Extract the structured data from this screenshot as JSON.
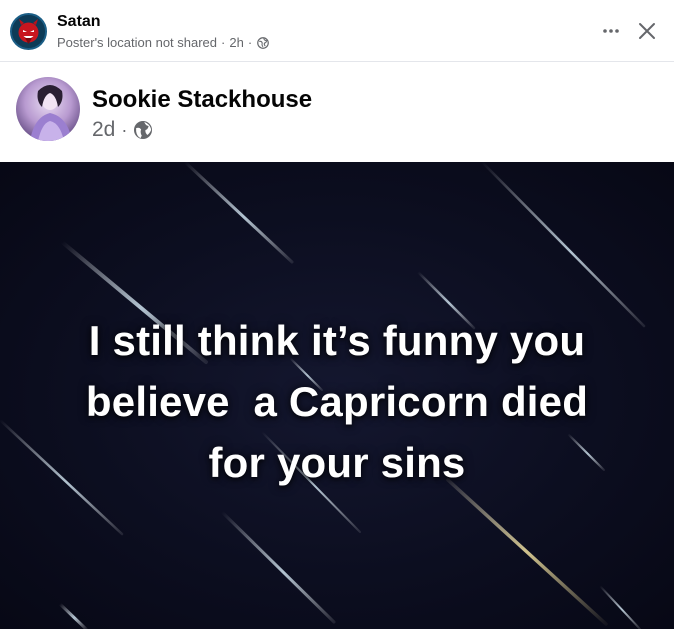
{
  "sharer": {
    "name": "Satan",
    "meta_location": "Poster's location not shared",
    "meta_time": "2h",
    "icons": [
      "devil-avatar-icon",
      "globe-icon",
      "more-icon",
      "close-icon"
    ]
  },
  "author": {
    "name": "Sookie Stackhouse",
    "time": "2d",
    "icons": [
      "avatar-photo",
      "globe-icon"
    ]
  },
  "post_image": {
    "lines": [
      "I still think it’s funny you",
      "believe  a Capricorn died",
      "for your sins"
    ],
    "background_color": "#0c0e20",
    "text_color": "#ffffff"
  },
  "colors": {
    "primary_text": "#050505",
    "secondary_text": "#65676b",
    "divider": "#e4e6eb"
  }
}
